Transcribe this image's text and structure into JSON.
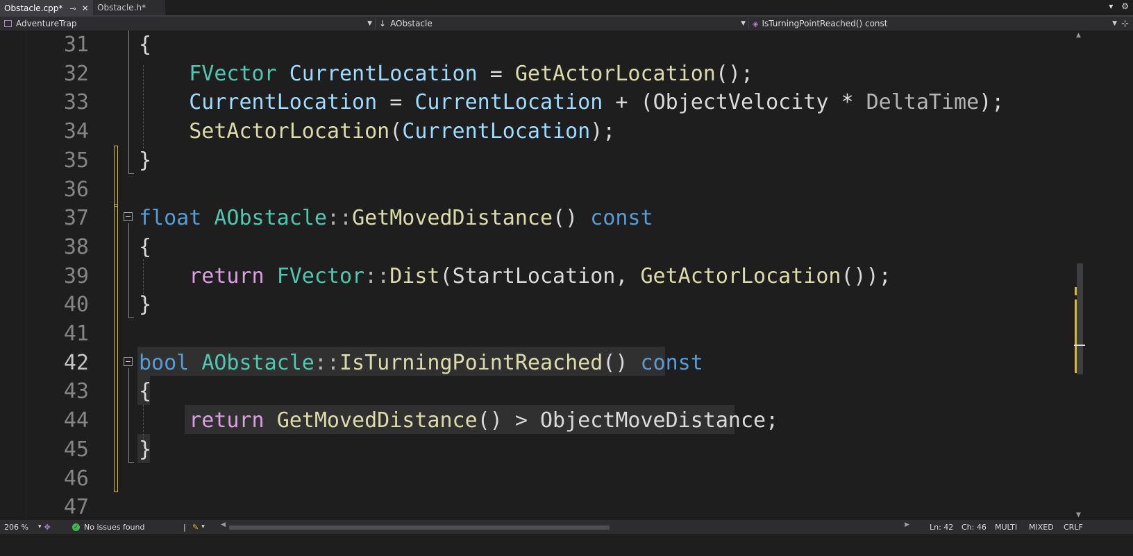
{
  "tabs": [
    {
      "label": "Obstacle.cpp*",
      "active": true,
      "pin_icon": "pin-icon",
      "close_icon": "close-icon"
    },
    {
      "label": "Obstacle.h*",
      "active": false
    }
  ],
  "tabbar_right": {
    "dropdown_icon": "chevron-down-icon",
    "settings_icon": "gear-icon"
  },
  "navbar": {
    "project": "AdventureTrap",
    "scope": "AObstacle",
    "member": "IsTurningPointReached() const"
  },
  "editor": {
    "current_line": "42",
    "lines": [
      {
        "num": "31",
        "parts": [
          {
            "t": "{",
            "c": "pl"
          }
        ]
      },
      {
        "num": "32",
        "parts": [
          {
            "t": "    ",
            "c": "pl"
          },
          {
            "t": "FVector",
            "c": "ty"
          },
          {
            "t": " ",
            "c": "pl"
          },
          {
            "t": "CurrentLocation",
            "c": "va"
          },
          {
            "t": " = ",
            "c": "pl"
          },
          {
            "t": "GetActorLocation",
            "c": "fn"
          },
          {
            "t": "();",
            "c": "pl"
          }
        ]
      },
      {
        "num": "33",
        "parts": [
          {
            "t": "    ",
            "c": "pl"
          },
          {
            "t": "CurrentLocation",
            "c": "va"
          },
          {
            "t": " = ",
            "c": "pl"
          },
          {
            "t": "CurrentLocation",
            "c": "va"
          },
          {
            "t": " + (",
            "c": "pl"
          },
          {
            "t": "ObjectVelocity",
            "c": "pl"
          },
          {
            "t": " * ",
            "c": "pl"
          },
          {
            "t": "DeltaTime",
            "c": "pu"
          },
          {
            "t": ");",
            "c": "pl"
          }
        ]
      },
      {
        "num": "34",
        "parts": [
          {
            "t": "    ",
            "c": "pl"
          },
          {
            "t": "SetActorLocation",
            "c": "fn"
          },
          {
            "t": "(",
            "c": "pl"
          },
          {
            "t": "CurrentLocation",
            "c": "va"
          },
          {
            "t": ");",
            "c": "pl"
          }
        ]
      },
      {
        "num": "35",
        "parts": [
          {
            "t": "}",
            "c": "pl"
          }
        ]
      },
      {
        "num": "36",
        "parts": []
      },
      {
        "num": "37",
        "parts": [
          {
            "t": "float",
            "c": "kw"
          },
          {
            "t": " ",
            "c": "pl"
          },
          {
            "t": "AObstacle",
            "c": "ty"
          },
          {
            "t": "::",
            "c": "pu"
          },
          {
            "t": "GetMovedDistance",
            "c": "fn"
          },
          {
            "t": "() ",
            "c": "pl"
          },
          {
            "t": "const",
            "c": "kw"
          }
        ]
      },
      {
        "num": "38",
        "parts": [
          {
            "t": "{",
            "c": "pl"
          }
        ]
      },
      {
        "num": "39",
        "parts": [
          {
            "t": "    ",
            "c": "pl"
          },
          {
            "t": "return",
            "c": "kc"
          },
          {
            "t": " ",
            "c": "pl"
          },
          {
            "t": "FVector",
            "c": "ty"
          },
          {
            "t": "::",
            "c": "pu"
          },
          {
            "t": "Dist",
            "c": "fn"
          },
          {
            "t": "(",
            "c": "pl"
          },
          {
            "t": "StartLocation",
            "c": "pl"
          },
          {
            "t": ", ",
            "c": "pl"
          },
          {
            "t": "GetActorLocation",
            "c": "fn"
          },
          {
            "t": "());",
            "c": "pl"
          }
        ]
      },
      {
        "num": "40",
        "parts": [
          {
            "t": "}",
            "c": "pl"
          }
        ]
      },
      {
        "num": "41",
        "parts": []
      },
      {
        "num": "42",
        "parts": [
          {
            "t": "bool",
            "c": "kw"
          },
          {
            "t": " ",
            "c": "pl"
          },
          {
            "t": "AObstacle",
            "c": "ty"
          },
          {
            "t": "::",
            "c": "pu"
          },
          {
            "t": "IsTurningPointReached",
            "c": "fn"
          },
          {
            "t": "() ",
            "c": "pl"
          },
          {
            "t": "const",
            "c": "kw"
          }
        ]
      },
      {
        "num": "43",
        "parts": [
          {
            "t": "{",
            "c": "pl"
          }
        ]
      },
      {
        "num": "44",
        "parts": [
          {
            "t": "    ",
            "c": "pl"
          },
          {
            "t": "return",
            "c": "kc"
          },
          {
            "t": " ",
            "c": "pl"
          },
          {
            "t": "GetMovedDistance",
            "c": "fn"
          },
          {
            "t": "() > ",
            "c": "pl"
          },
          {
            "t": "ObjectMoveDistance",
            "c": "pl"
          },
          {
            "t": ";",
            "c": "pl"
          }
        ]
      },
      {
        "num": "45",
        "parts": [
          {
            "t": "}",
            "c": "pl"
          }
        ]
      },
      {
        "num": "46",
        "parts": []
      },
      {
        "num": "47",
        "parts": []
      }
    ]
  },
  "colors": {
    "keyword": "#569cd6",
    "control_keyword": "#d8a0df",
    "type": "#4ec9b0",
    "function": "#dcdcaa",
    "variable": "#9cdcfe",
    "change_marker": "#d7ba2c"
  },
  "status": {
    "zoom": "206 %",
    "issues": "No issues found",
    "issues_icon": "check-circle-icon",
    "brush_icon": "brush-icon",
    "line": "Ln: 42",
    "char": "Ch: 46",
    "mode": "MULTI",
    "tabs": "MIXED",
    "eol": "CRLF"
  }
}
